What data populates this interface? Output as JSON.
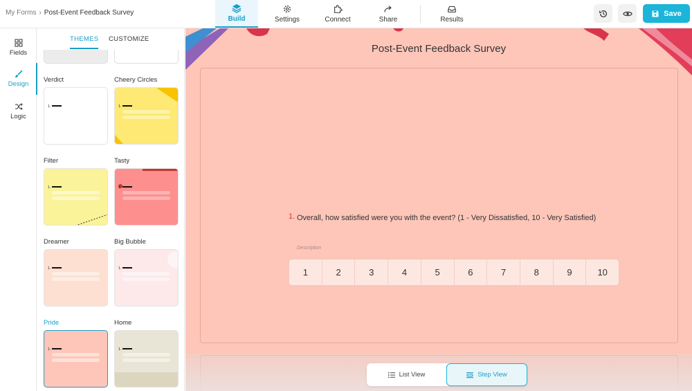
{
  "breadcrumb": {
    "parent": "My Forms",
    "separator": "›",
    "current": "Post-Event Feedback Survey"
  },
  "nav": [
    {
      "label": "Build",
      "icon": "layers-icon",
      "active": true
    },
    {
      "label": "Settings",
      "icon": "gear-icon"
    },
    {
      "label": "Connect",
      "icon": "puzzle-icon"
    },
    {
      "label": "Share",
      "icon": "share-arrow-icon"
    },
    {
      "label": "Results",
      "icon": "inbox-icon"
    }
  ],
  "actions": {
    "history_icon": "history-icon",
    "preview_icon": "eye-icon",
    "save_label": "Save"
  },
  "rail": [
    {
      "label": "Fields",
      "icon": "grid-icon"
    },
    {
      "label": "Design",
      "icon": "brush-icon",
      "active": true
    },
    {
      "label": "Logic",
      "icon": "shuffle-icon"
    }
  ],
  "panel": {
    "tabs": [
      {
        "label": "THEMES",
        "active": true
      },
      {
        "label": "CUSTOMIZE"
      }
    ],
    "themes": [
      {
        "name": "Verdict",
        "bg": "#ffffff"
      },
      {
        "name": "Cheery Circles",
        "bg": "#fde974"
      },
      {
        "name": "Filter",
        "bg": "#fbf39a"
      },
      {
        "name": "Tasty",
        "bg": "#fd8f8f"
      },
      {
        "name": "Dreamer",
        "bg": "#fde0d2"
      },
      {
        "name": "Big Bubble",
        "bg": "#fde8ea"
      },
      {
        "name": "Pride",
        "bg": "#fdc6b9",
        "selected": true
      },
      {
        "name": "Home",
        "bg": "#e9e5d6"
      }
    ]
  },
  "form": {
    "title": "Post-Event Feedback Survey",
    "question_number": "1.",
    "question_text": "Overall, how satisfied were you with the event? (1 - Very Dissatisfied, 10 - Very Satisfied)",
    "description_placeholder": "Description",
    "scale": [
      "1",
      "2",
      "3",
      "4",
      "5",
      "6",
      "7",
      "8",
      "9",
      "10"
    ]
  },
  "views": {
    "list": "List View",
    "step": "Step View",
    "active": "step"
  },
  "colors": {
    "accent": "#1ab5d8",
    "canvas": "#fdc6b9",
    "question_number": "#d23b3b"
  }
}
